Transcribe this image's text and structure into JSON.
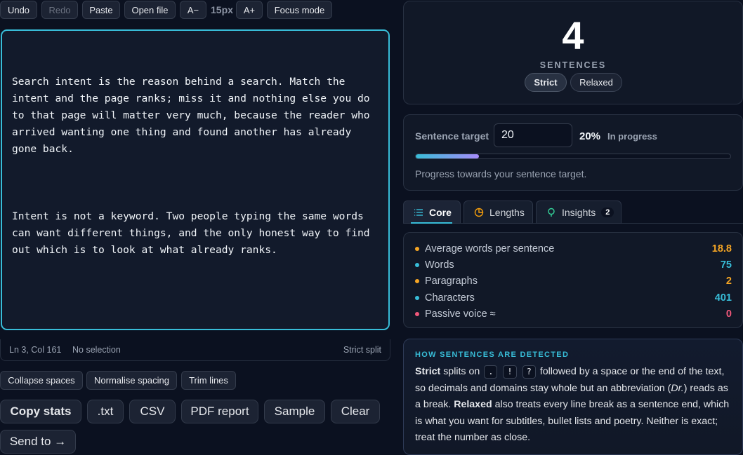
{
  "toolbar": {
    "undo": "Undo",
    "redo": "Redo",
    "paste": "Paste",
    "open_file": "Open file",
    "font_decrease": "A−",
    "font_size": "15px",
    "font_increase": "A+",
    "focus_mode": "Focus mode"
  },
  "editor": {
    "paragraphs": [
      "Search intent is the reason behind a search. Match the intent and the page ranks; miss it and nothing else you do to that page will matter very much, because the reader who arrived wanting one thing and found another has already gone back.",
      "Intent is not a keyword. Two people typing the same words can want different things, and the only honest way to find out which is to look at what already ranks."
    ]
  },
  "statusbar": {
    "position": "Ln 3, Col 161",
    "selection": "No selection",
    "mode": "Strict split"
  },
  "cleanup": {
    "collapse_spaces": "Collapse spaces",
    "normalise_spacing": "Normalise spacing",
    "trim_lines": "Trim lines"
  },
  "actions": {
    "copy_stats": "Copy stats",
    "txt": ".txt",
    "csv": "CSV",
    "pdf_report": "PDF report",
    "sample": "Sample",
    "clear": "Clear",
    "send_to": "Send to →"
  },
  "summary": {
    "count": "4",
    "label": "SENTENCES",
    "modes": [
      "Strict",
      "Relaxed"
    ],
    "active_mode": "Strict"
  },
  "target": {
    "label": "Sentence target",
    "value": "20",
    "percent": "20%",
    "progress_fraction": 0.2,
    "status": "In progress",
    "hint": "Progress towards your sentence target."
  },
  "tabs": [
    {
      "label": "Core",
      "icon": "list-icon",
      "active": true
    },
    {
      "label": "Lengths",
      "icon": "pie-chart-icon",
      "active": false
    },
    {
      "label": "Insights",
      "icon": "lightbulb-icon",
      "active": false,
      "badge": "2"
    }
  ],
  "stats": [
    {
      "label": "Average words per sentence",
      "value": "18.8",
      "color": "#f5a524"
    },
    {
      "label": "Words",
      "value": "75",
      "color": "#38bdd8"
    },
    {
      "label": "Paragraphs",
      "value": "2",
      "color": "#f5a524"
    },
    {
      "label": "Characters",
      "value": "401",
      "color": "#38bdd8"
    },
    {
      "label": "Passive voice ≈",
      "value": "0",
      "color": "#f0577a"
    }
  ],
  "info": {
    "title": "HOW SENTENCES ARE DETECTED",
    "strict_word": "Strict",
    "text_1": " splits on ",
    "keys": [
      ".",
      "!",
      "?"
    ],
    "text_2": " followed by a space or the end of the text, so decimals and domains stay whole but an abbreviation (",
    "abbr": "Dr.",
    "text_3": ") reads as a break. ",
    "relaxed_word": "Relaxed",
    "text_4": " also treats every line break as a sentence end, which is what you want for subtitles, bullet lists and poetry. Neither is exact; treat the number as close."
  },
  "colors": {
    "accent": "#38bdd8",
    "accent_gradient_end": "#a78bfa",
    "background": "#0b1120",
    "panel": "#111827"
  }
}
